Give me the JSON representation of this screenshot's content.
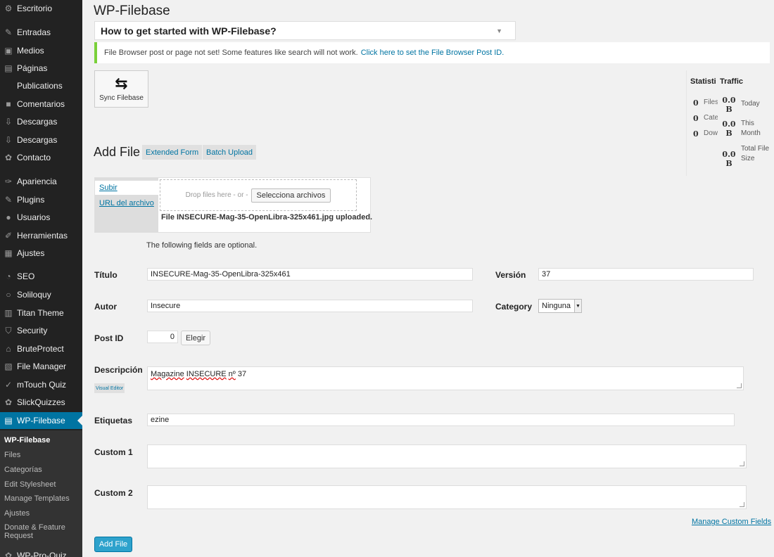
{
  "sidebar": {
    "items": [
      {
        "label": "Escritorio",
        "icon": "dashboard-icon",
        "glyph": "⚙"
      },
      {
        "label": "Entradas",
        "icon": "pin-icon",
        "glyph": "✎"
      },
      {
        "label": "Medios",
        "icon": "media-icon",
        "glyph": "▣"
      },
      {
        "label": "Páginas",
        "icon": "pages-icon",
        "glyph": "▤"
      },
      {
        "label": "Publications",
        "icon": "publications-icon",
        "glyph": " "
      },
      {
        "label": "Comentarios",
        "icon": "comments-icon",
        "glyph": "■"
      },
      {
        "label": "Descargas",
        "icon": "download-icon",
        "glyph": "⇩"
      },
      {
        "label": "Descargas",
        "icon": "download-icon",
        "glyph": "⇩"
      },
      {
        "label": "Contacto",
        "icon": "contact-icon",
        "glyph": "✿"
      },
      {
        "label": "Apariencia",
        "icon": "brush-icon",
        "glyph": "✑"
      },
      {
        "label": "Plugins",
        "icon": "plugin-icon",
        "glyph": "✎"
      },
      {
        "label": "Usuarios",
        "icon": "users-icon",
        "glyph": "●"
      },
      {
        "label": "Herramientas",
        "icon": "tools-icon",
        "glyph": "✐"
      },
      {
        "label": "Ajustes",
        "icon": "settings-icon",
        "glyph": "▦"
      },
      {
        "label": "SEO",
        "icon": "seo-icon",
        "glyph": "◔"
      },
      {
        "label": "Soliloquy",
        "icon": "soliloquy-icon",
        "glyph": "○"
      },
      {
        "label": "Titan Theme",
        "icon": "titan-icon",
        "glyph": "▥"
      },
      {
        "label": "Security",
        "icon": "shield-icon",
        "glyph": "⛉"
      },
      {
        "label": "BruteProtect",
        "icon": "lock-icon",
        "glyph": "⌂"
      },
      {
        "label": "File Manager",
        "icon": "file-manager-icon",
        "glyph": "▧"
      },
      {
        "label": "mTouch Quiz",
        "icon": "check-icon",
        "glyph": "✓"
      },
      {
        "label": "SlickQuizzes",
        "icon": "gear-icon",
        "glyph": "✿"
      },
      {
        "label": "WP-Filebase",
        "icon": "filebase-icon",
        "glyph": "▤"
      }
    ],
    "submenu": [
      "WP-Filebase",
      "Files",
      "Categorías",
      "Edit Stylesheet",
      "Manage Templates",
      "Ajustes",
      "Donate & Feature Request"
    ],
    "bottom_item": {
      "label": "WP-Pro-Quiz",
      "glyph": "✿"
    }
  },
  "page": {
    "title": "WP-Filebase",
    "help_select": "How to get started with WP-Filebase?",
    "notice_text": "File Browser post or page not set! Some features like search will not work.",
    "notice_link": "Click here to set the File Browser Post ID.",
    "sync_label": "Sync Filebase"
  },
  "stats": {
    "statistics_header": "Statisti",
    "traffic_header": "Traffic",
    "rows": [
      {
        "value": "0",
        "label": "Files"
      },
      {
        "value": "0",
        "label": "Cate"
      },
      {
        "value": "0",
        "label": "Dow"
      }
    ],
    "traffic": [
      {
        "value": "0.0 B",
        "label": "Today"
      },
      {
        "value": "0.0 B",
        "label": "This Month"
      },
      {
        "value": "0.0 B",
        "label": "Total File Size"
      }
    ]
  },
  "form": {
    "title": "Add File",
    "extended_form": "Extended Form",
    "batch_upload": "Batch Upload",
    "upload_tab": "Subir",
    "url_tab": "URL del archivo",
    "drop_text": "Drop files here - or -",
    "select_files": "Selecciona archivos",
    "uploaded_msg": "File INSECURE-Mag-35-OpenLibra-325x461.jpg uploaded.",
    "optional_note": "The following fields are optional.",
    "titulo_label": "Título",
    "titulo_value": "INSECURE-Mag-35-OpenLibra-325x461",
    "version_label": "Versión",
    "version_value": "37",
    "autor_label": "Autor",
    "autor_value": "Insecure",
    "category_label": "Category",
    "category_value": "Ninguna",
    "postid_label": "Post ID",
    "postid_value": "0",
    "elegir": "Elegir",
    "descripcion_label": "Descripción",
    "visual_editor": "Visual Editor",
    "desc_word1": "Magazine",
    "desc_word2": "INSECURE",
    "desc_word3": "nº",
    "desc_word4": "37",
    "etiquetas_label": "Etiquetas",
    "etiquetas_value": "ezine",
    "custom1_label": "Custom 1",
    "custom2_label": "Custom 2",
    "manage_fields": "Manage Custom Fields",
    "add_file_button": "Add File"
  }
}
